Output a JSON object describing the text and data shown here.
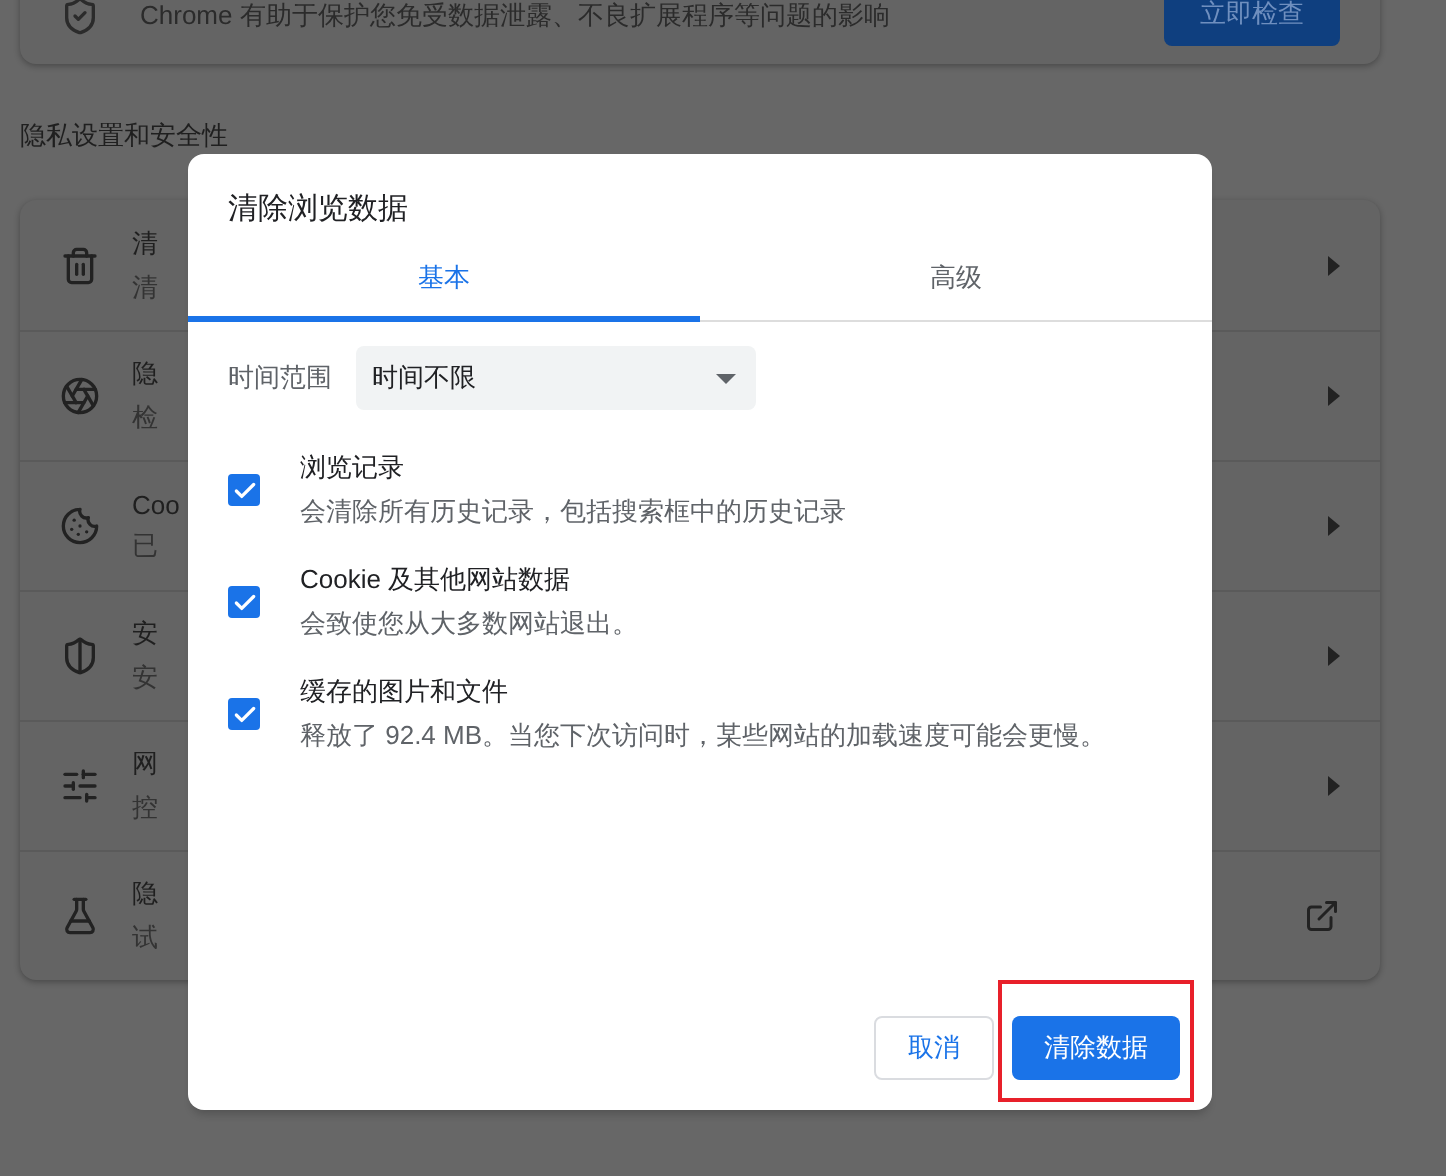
{
  "top_card": {
    "message": "Chrome 有助于保护您免受数据泄露、不良扩展程序等问题的影响",
    "button": "立即检查"
  },
  "section_title": "隐私设置和安全性",
  "settings_list": [
    {
      "kind": "submenu",
      "title": "清",
      "subtitle": "清"
    },
    {
      "kind": "submenu",
      "title": "隐",
      "subtitle": "检"
    },
    {
      "kind": "submenu",
      "title": "Coo",
      "subtitle": "已"
    },
    {
      "kind": "submenu",
      "title": "安",
      "subtitle": "安"
    },
    {
      "kind": "submenu",
      "title": "网",
      "subtitle": "控"
    },
    {
      "kind": "external",
      "title": "隐",
      "subtitle": "试"
    }
  ],
  "dialog": {
    "title": "清除浏览数据",
    "tabs": [
      {
        "label": "基本",
        "selected": true
      },
      {
        "label": "高级",
        "selected": false
      }
    ],
    "time_range": {
      "label": "时间范围",
      "value": "时间不限"
    },
    "options": [
      {
        "title": "浏览记录",
        "description": "会清除所有历史记录，包括搜索框中的历史记录",
        "checked": true
      },
      {
        "title": "Cookie 及其他网站数据",
        "description": "会致使您从大多数网站退出。",
        "checked": true
      },
      {
        "title": "缓存的图片和文件",
        "description": "释放了 92.4 MB。当您下次访问时，某些网站的加载速度可能会更慢。",
        "checked": true
      }
    ],
    "buttons": [
      {
        "label": "取消",
        "kind": "secondary"
      },
      {
        "label": "清除数据",
        "kind": "primary",
        "highlighted": true
      }
    ]
  }
}
